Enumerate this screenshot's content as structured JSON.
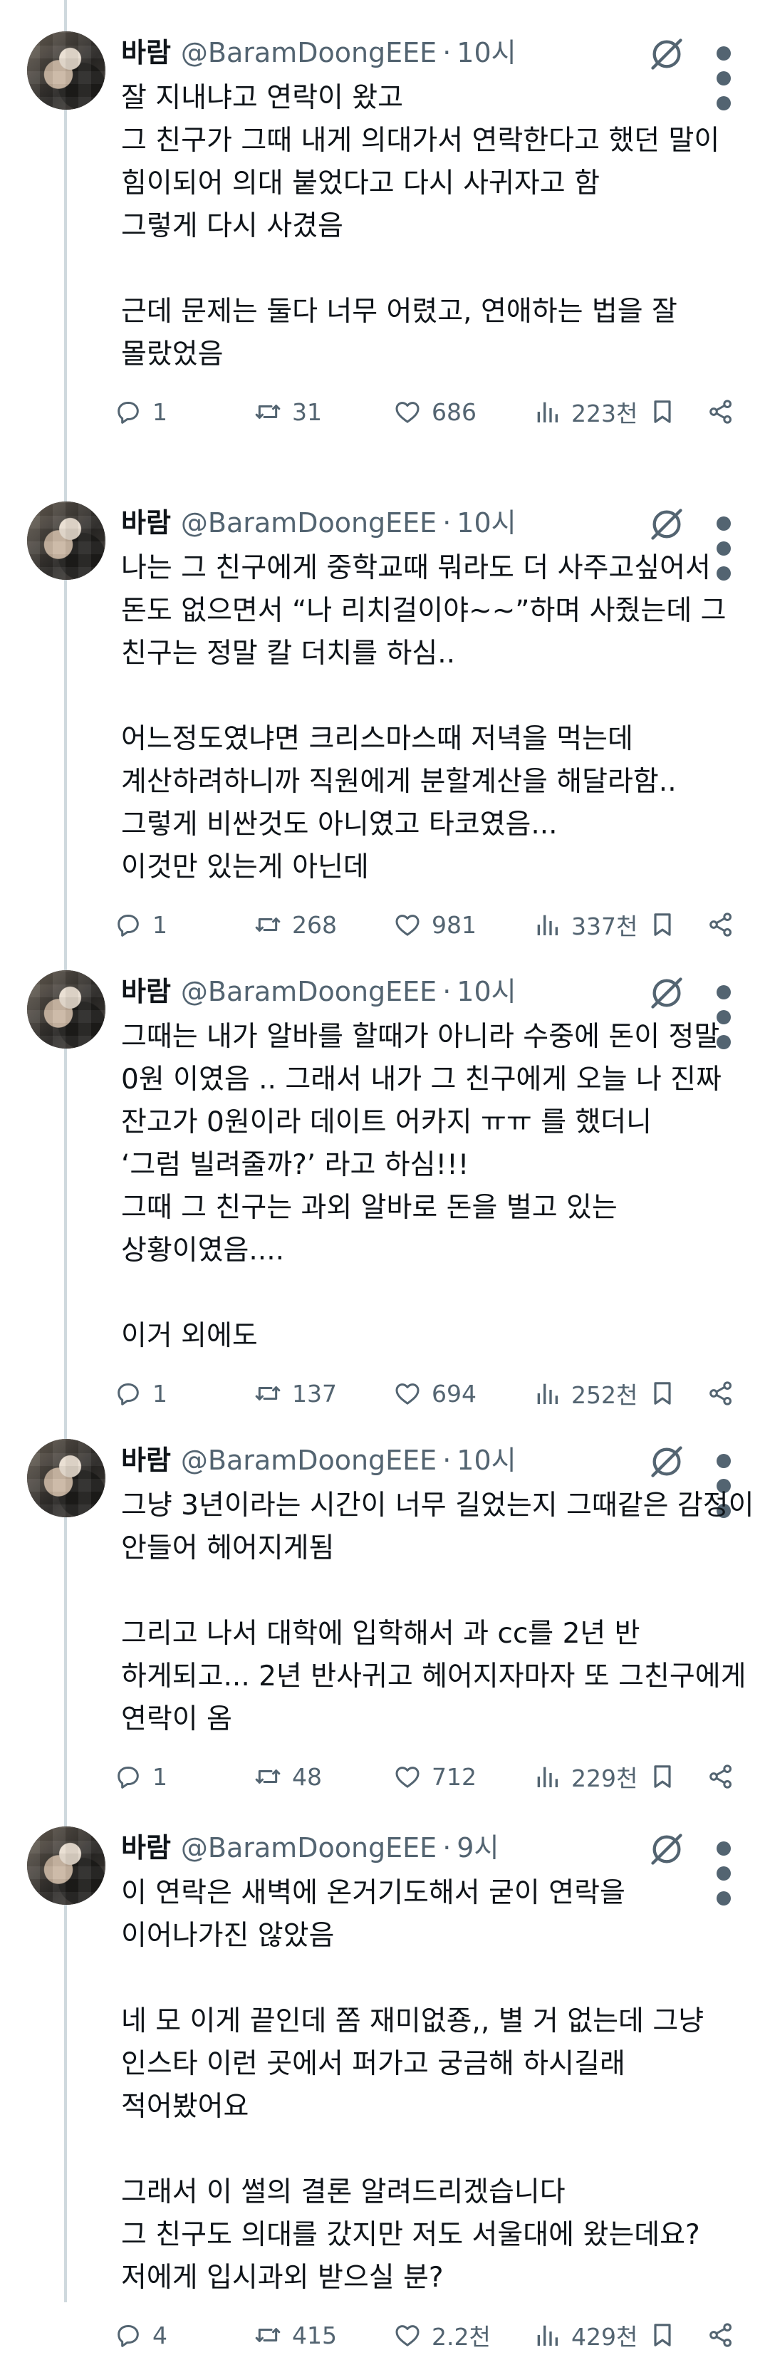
{
  "author": {
    "name": "바람",
    "handle": "@BaramDoongEEE",
    "separator": "·"
  },
  "icons": {
    "reply": "reply-icon",
    "retweet": "retweet-icon",
    "like": "heart-icon",
    "views": "views-bar-chart-icon",
    "bookmark": "bookmark-icon",
    "share": "share-icon",
    "grok": "grok-icon",
    "more": "more-dots-icon"
  },
  "colors": {
    "text": "#0f1419",
    "secondary": "#536471",
    "thread_line": "#cfd9de"
  },
  "tweets": [
    {
      "time": "10시",
      "paragraphs": [
        [
          "잘 지내냐고 연락이 왔고",
          "그 친구가 그때 내게 의대가서 연락한다고 했던 말이",
          "힘이되어 의대 붙었다고 다시 사귀자고 함",
          "그렇게 다시 사겼음"
        ],
        [
          "근데 문제는 둘다 너무 어렸고, 연애하는 법을 잘",
          "몰랐었음"
        ]
      ],
      "replies": "1",
      "retweets": "31",
      "likes": "686",
      "views": "223천"
    },
    {
      "time": "10시",
      "paragraphs": [
        [
          "나는 그 친구에게 중학교때 뭐라도 더 사주고싶어서",
          "돈도 없으면서 “나 리치걸이야~~”하며 사줬는데 그",
          "친구는 정말 칼 더치를 하심.."
        ],
        [
          "어느정도였냐면 크리스마스때 저녁을 먹는데",
          "계산하려하니까 직원에게 분할계산을 해달라함..",
          "그렇게 비싼것도 아니였고 타코였음...",
          "이것만 있는게 아닌데"
        ]
      ],
      "replies": "1",
      "retweets": "268",
      "likes": "981",
      "views": "337천"
    },
    {
      "time": "10시",
      "paragraphs": [
        [
          "그때는 내가 알바를 할때가 아니라 수중에 돈이 정말",
          "0원 이였음 .. 그래서 내가 그 친구에게 오늘 나 진짜",
          "잔고가 0원이라 데이트 어카지 ㅠㅠ 를 했더니",
          "‘그럼 빌려줄까?’ 라고 하심!!!",
          "그때 그 친구는 과외 알바로 돈을 벌고 있는",
          "상황이였음...."
        ],
        [
          "이거 외에도"
        ]
      ],
      "replies": "1",
      "retweets": "137",
      "likes": "694",
      "views": "252천"
    },
    {
      "time": "10시",
      "paragraphs": [
        [
          "그냥 3년이라는 시간이 너무 길었는지 그때같은 감정이",
          "안들어 헤어지게됨"
        ],
        [
          "그리고 나서 대학에 입학해서 과 cc를 2년 반",
          "하게되고... 2년 반사귀고 헤어지자마자 또 그친구에게",
          "연락이 옴"
        ]
      ],
      "replies": "1",
      "retweets": "48",
      "likes": "712",
      "views": "229천"
    },
    {
      "time": "9시",
      "paragraphs": [
        [
          "이 연락은 새벽에 온거기도해서 굳이 연락을",
          "이어나가진 않았음"
        ],
        [
          "네 모 이게 끝인데 쫌 재미없죵,, 별 거 없는데 그냥",
          "인스타 이런 곳에서 퍼가고 궁금해 하시길래",
          "적어봤어요"
        ],
        [
          "그래서 이 썰의 결론 알려드리겠습니다",
          "그 친구도 의대를 갔지만 저도 서울대에 왔는데요?",
          "저에게 입시과외 받으실 분?"
        ]
      ],
      "replies": "4",
      "retweets": "415",
      "likes": "2.2천",
      "views": "429천"
    }
  ]
}
